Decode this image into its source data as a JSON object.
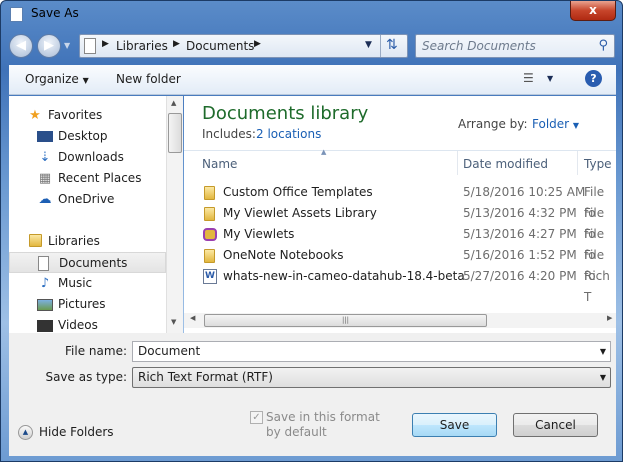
{
  "window": {
    "title": "Save As",
    "close_label": "x"
  },
  "address": {
    "segments": [
      "Libraries",
      "Documents"
    ],
    "search_placeholder": "Search Documents"
  },
  "toolbar": {
    "organize": "Organize",
    "new_folder": "New folder"
  },
  "nav": {
    "favorites": "Favorites",
    "favorites_items": [
      "Desktop",
      "Downloads",
      "Recent Places",
      "OneDrive"
    ],
    "libraries": "Libraries",
    "libraries_items": [
      "Documents",
      "Music",
      "Pictures",
      "Videos"
    ],
    "selected": "Documents"
  },
  "main": {
    "title": "Documents library",
    "includes_label": "Includes:",
    "includes_link": "2 locations",
    "arrange_label": "Arrange by:",
    "arrange_value": "Folder",
    "columns": [
      "Name",
      "Date modified",
      "Type"
    ],
    "files": [
      {
        "name": "Custom Office Templates",
        "date": "5/18/2016 10:25 AM",
        "type": "File fo",
        "icon": "folder"
      },
      {
        "name": "My Viewlet Assets Library",
        "date": "5/13/2016 4:32 PM",
        "type": "File fo",
        "icon": "folder"
      },
      {
        "name": "My Viewlets",
        "date": "5/13/2016 4:27 PM",
        "type": "File fo",
        "icon": "special-folder"
      },
      {
        "name": "OneNote Notebooks",
        "date": "5/16/2016 1:52 PM",
        "type": "File fo",
        "icon": "folder"
      },
      {
        "name": "whats-new-in-cameo-datahub-18.4-beta",
        "date": "5/27/2016 4:20 PM",
        "type": "Rich T",
        "icon": "word-document"
      }
    ]
  },
  "form": {
    "file_name_label": "File name:",
    "file_name_value": "Document",
    "type_label": "Save as type:",
    "type_value": "Rich Text Format (RTF)",
    "checkbox_label": "Save in this format by default",
    "checkbox_checked": true,
    "save": "Save",
    "cancel": "Cancel",
    "hide_folders": "Hide Folders"
  }
}
